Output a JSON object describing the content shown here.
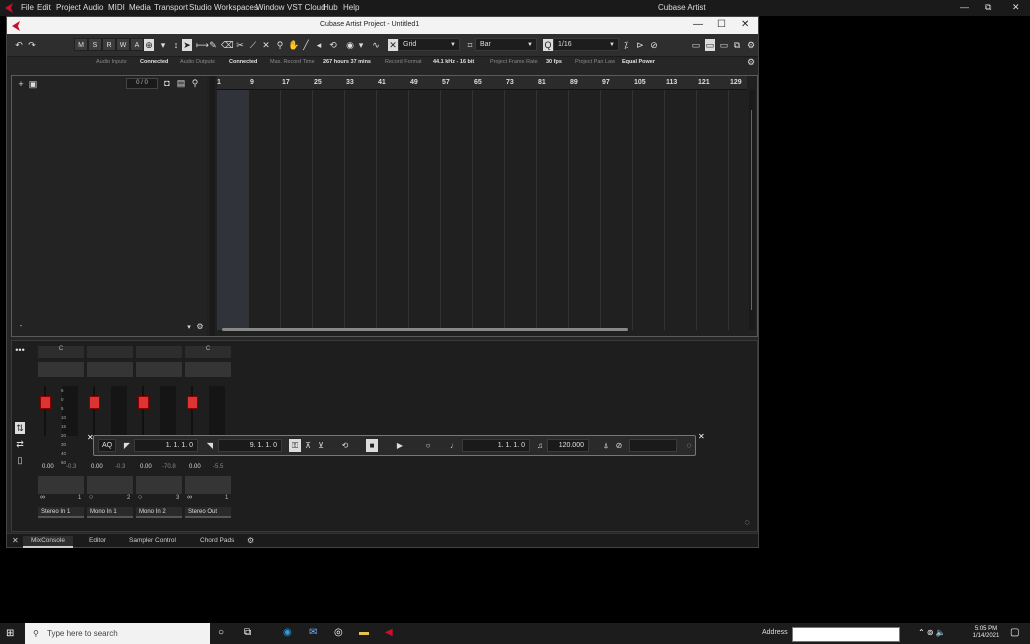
{
  "os_menubar": {
    "menus": [
      "File",
      "Edit",
      "Project",
      "Audio",
      "MIDI",
      "Media",
      "Transport",
      "Studio",
      "Workspaces",
      "Window",
      "VST Cloud",
      "Hub",
      "Help"
    ],
    "app_title": "Cubase Artist",
    "min_glyph": "—",
    "max_glyph": "⧉",
    "close_glyph": "✕"
  },
  "window": {
    "title": "Cubase Artist Project - Untitled1",
    "min_glyph": "—",
    "max_glyph": "☐",
    "close_glyph": "✕"
  },
  "toolbar": {
    "mode_buttons": [
      "M",
      "S",
      "R",
      "W",
      "A"
    ],
    "snap_label": "Grid",
    "snap_type": "Bar",
    "quantize_value": "1/16"
  },
  "status": {
    "audio_inputs_label": "Audio Inputs",
    "audio_inputs_value": "Connected",
    "audio_outputs_label": "Audio Outputs",
    "audio_outputs_value": "Connected",
    "max_record_label": "Max. Record Time",
    "max_record_value": "267 hours 37 mins",
    "record_format_label": "Record Format",
    "record_format_value": "44.1 kHz - 16 bit",
    "frame_rate_label": "Project Frame Rate",
    "frame_rate_value": "30 fps",
    "pan_law_label": "Project Pan Law",
    "pan_law_value": "Equal Power"
  },
  "track_header": {
    "track_count": "0 / 0"
  },
  "ruler": {
    "bars": [
      "1",
      "9",
      "17",
      "25",
      "33",
      "41",
      "49",
      "57",
      "65",
      "73",
      "81",
      "89",
      "97",
      "105",
      "113",
      "121",
      "129"
    ]
  },
  "mixer": {
    "channels": [
      {
        "name": "Stereo In 1",
        "pan": "C",
        "volume": "0.00",
        "peak": "-0.3",
        "index": "1"
      },
      {
        "name": "Mono In 1",
        "pan": "",
        "volume": "0.00",
        "peak": "-0.3",
        "index": "2"
      },
      {
        "name": "Mono In 2",
        "pan": "",
        "volume": "0.00",
        "peak": "-70.8",
        "index": "3"
      },
      {
        "name": "Stereo Out",
        "pan": "C",
        "volume": "0.00",
        "peak": "-5.5",
        "index": "1"
      }
    ],
    "meter_scale": [
      "6",
      "0",
      "5",
      "10",
      "15",
      "20",
      "30",
      "40",
      "50"
    ]
  },
  "bottom_tabs": [
    "MixConsole",
    "Editor",
    "Sampler Control",
    "Chord Pads"
  ],
  "transport": {
    "left_locator": "1. 1. 1.   0",
    "right_locator": "9. 1. 1.   0",
    "position": "1. 1. 1.   0",
    "tempo": "120.000",
    "aq_label": "AQ"
  },
  "taskbar": {
    "search_placeholder": "Type here to search",
    "address_label": "Address",
    "time": "5:05 PM",
    "date": "1/14/2021"
  },
  "colors": {
    "accent": "#c8102e",
    "fader_red": "#d33",
    "background": "#262626"
  }
}
